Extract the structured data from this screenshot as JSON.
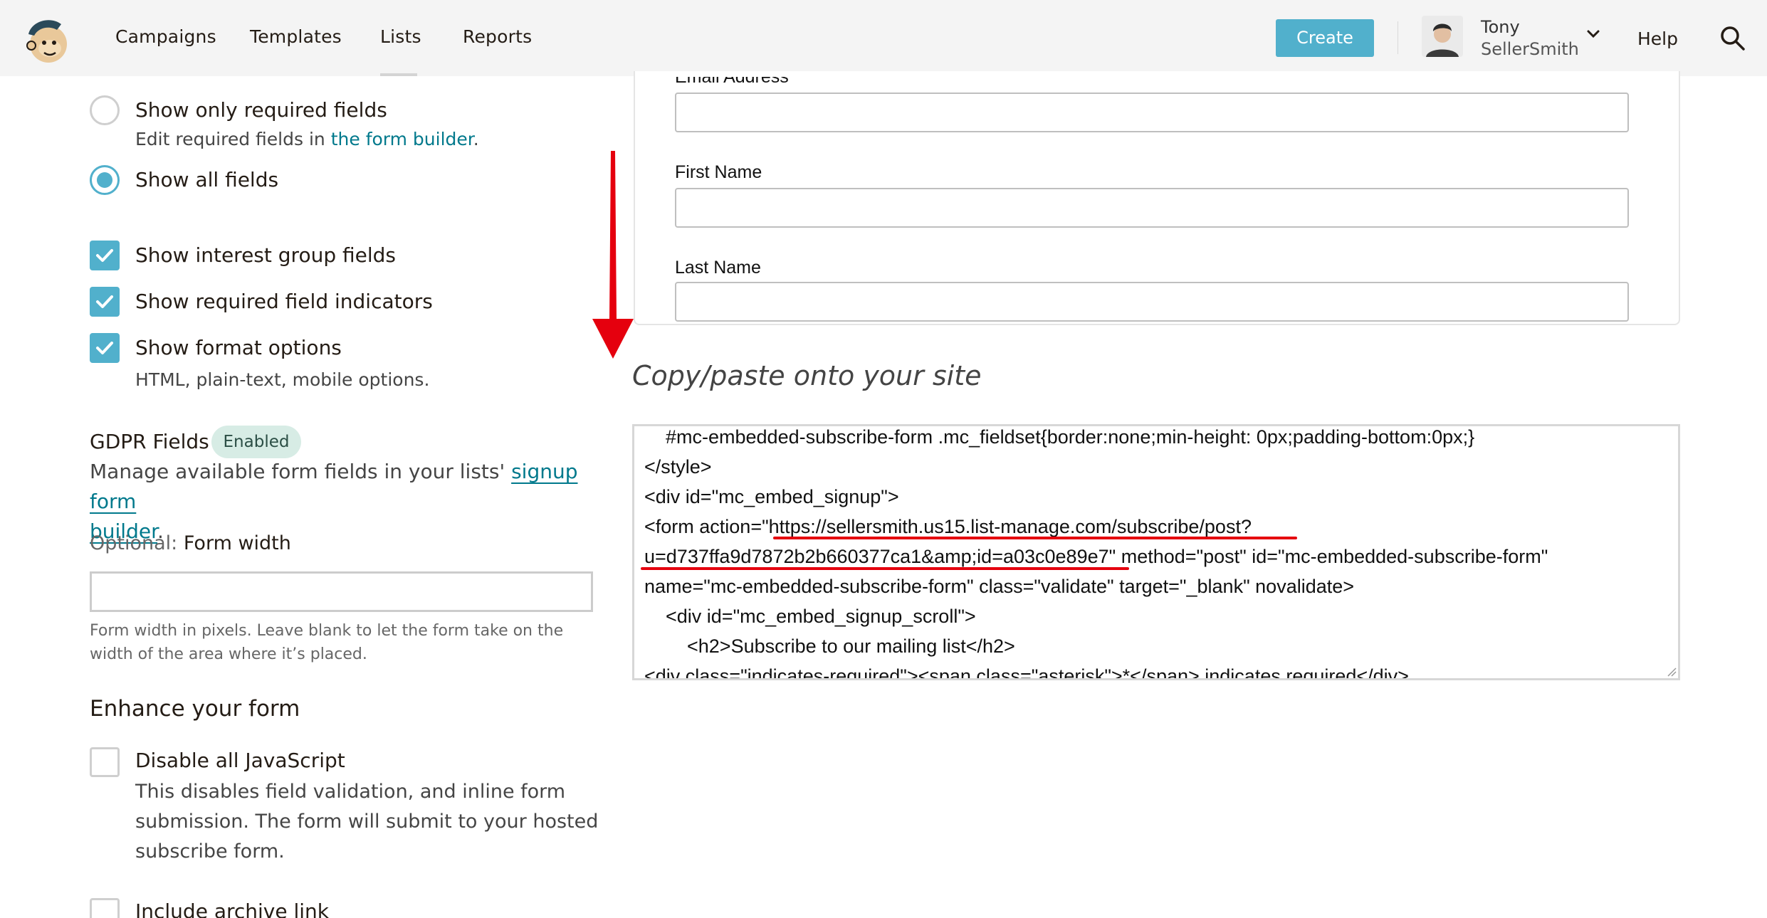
{
  "nav": {
    "links": [
      "Campaigns",
      "Templates",
      "Lists",
      "Reports"
    ],
    "create_label": "Create",
    "user_first": "Tony",
    "user_last": "SellerSmith",
    "help_label": "Help"
  },
  "settings": {
    "only_required_label": "Show only required fields",
    "only_required_sub_prefix": "Edit required fields in ",
    "only_required_sub_link": "the form builder",
    "only_required_sub_suffix": ".",
    "all_fields_label": "Show all fields",
    "interest_groups_label": "Show interest group fields",
    "required_indicators_label": "Show required field indicators",
    "format_options_label": "Show format options",
    "format_options_sub": "HTML, plain-text, mobile options.",
    "gdpr_title": "GDPR Fields",
    "gdpr_badge": "Enabled",
    "gdpr_desc_prefix": "Manage available form fields in your lists' ",
    "gdpr_desc_link1": "signup form",
    "gdpr_desc_link2": "builder",
    "gdpr_desc_suffix": ".",
    "width_optional": "Optional:",
    "width_label": "Form width",
    "width_value": "",
    "width_help_1": "Form width in pixels. Leave blank to let the form take on the",
    "width_help_2": "width of the area where it’s placed.",
    "enhance_title": "Enhance your form",
    "disable_js_label": "Disable all JavaScript",
    "disable_js_sub_1": "This disables field validation, and inline form",
    "disable_js_sub_2": "submission. The form will submit to your hosted",
    "disable_js_sub_3": "subscribe form.",
    "archive_label": "Include archive link"
  },
  "preview": {
    "email_label": "Email Address",
    "email_star": "*",
    "first_name_label": "First Name",
    "last_name_label": "Last Name"
  },
  "code": {
    "title": "Copy/paste onto your site",
    "lines": [
      "    #mc-embedded-subscribe-form .mc_fieldset{border:none;min-height: 0px;padding-bottom:0px;}",
      "</style>",
      "<div id=\"mc_embed_signup\">",
      "<form action=\"https://sellersmith.us15.list-manage.com/subscribe/post?",
      "u=d737ffa9d7872b2b660377ca1&amp;id=a03c0e89e7\" method=\"post\" id=\"mc-embedded-subscribe-form\"",
      "name=\"mc-embedded-subscribe-form\" class=\"validate\" target=\"_blank\" novalidate>",
      "    <div id=\"mc_embed_signup_scroll\">",
      "        <h2>Subscribe to our mailing list</h2>",
      "<div class=\"indicates-required\"><span class=\"asterisk\">*</span> indicates required</div>"
    ]
  },
  "colors": {
    "accent": "#51b0cc",
    "link": "#00798c",
    "annotation_red": "#e5000e"
  }
}
